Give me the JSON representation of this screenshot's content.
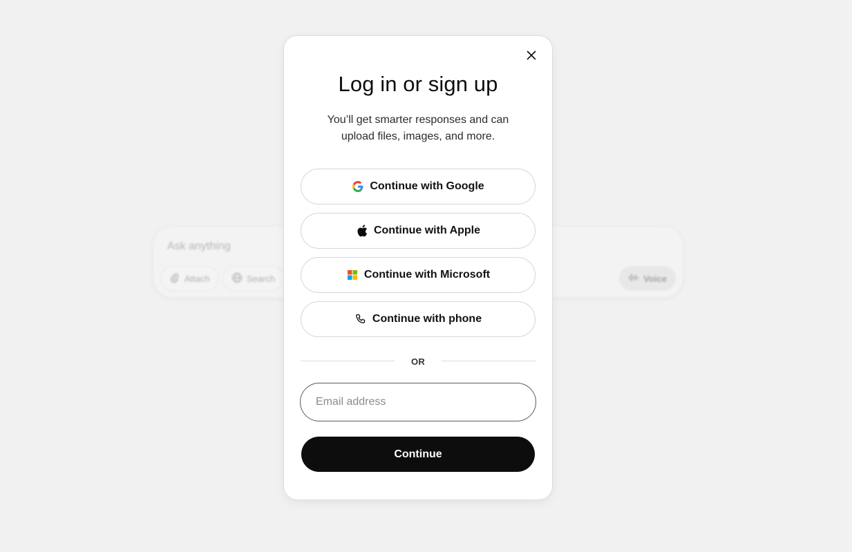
{
  "composer": {
    "placeholder": "Ask anything",
    "attach_label": "Attach",
    "search_label": "Search",
    "voice_label": "Voice"
  },
  "modal": {
    "title": "Log in or sign up",
    "subtitle": "You’ll get smarter responses and can upload files, images, and more.",
    "providers": [
      {
        "label": "Continue with Google",
        "icon": "google-icon"
      },
      {
        "label": "Continue with Apple",
        "icon": "apple-icon"
      },
      {
        "label": "Continue with Microsoft",
        "icon": "microsoft-icon"
      },
      {
        "label": "Continue with phone",
        "icon": "phone-icon"
      }
    ],
    "divider_text": "OR",
    "email_placeholder": "Email address",
    "continue_label": "Continue"
  },
  "colors": {
    "page_background": "#f1f1f1",
    "primary_button": "#0d0d0d",
    "google_blue": "#4285F4",
    "google_red": "#EA4335",
    "google_yellow": "#FBBC05",
    "google_green": "#34A853",
    "ms_red": "#F25022",
    "ms_green": "#7FBA00",
    "ms_blue": "#00A4EF",
    "ms_yellow": "#FFB900"
  }
}
